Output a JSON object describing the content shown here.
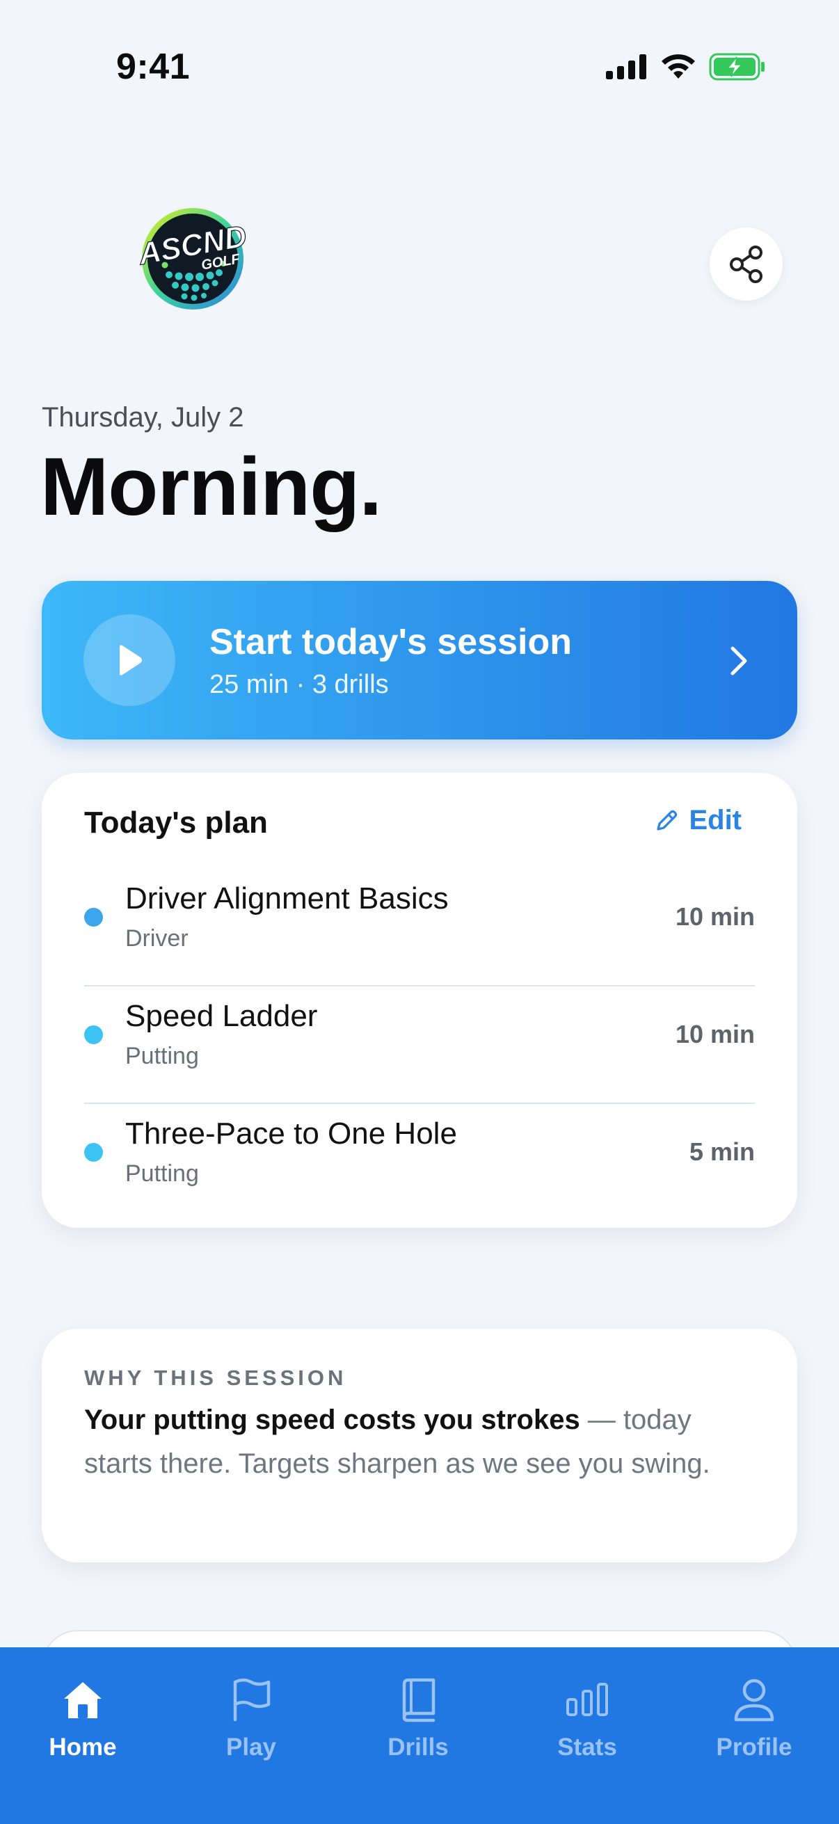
{
  "status_bar": {
    "time": "9:41"
  },
  "header": {
    "logo_text_main": "ASCND",
    "logo_text_sub": "GOLF",
    "date": "Thursday, July 2",
    "greeting": "Morning."
  },
  "session_cta": {
    "title": "Start today's session",
    "subtitle": "25 min · 3 drills"
  },
  "plan": {
    "title": "Today's plan",
    "edit_label": "Edit",
    "drills": [
      {
        "name": "Driver Alignment Basics",
        "category": "Driver",
        "duration": "10 min"
      },
      {
        "name": "Speed Ladder",
        "category": "Putting",
        "duration": "10 min"
      },
      {
        "name": "Three-Pace to One Hole",
        "category": "Putting",
        "duration": "5 min"
      }
    ]
  },
  "why": {
    "label": "WHY THIS SESSION",
    "text_bold": "Your putting speed costs you strokes",
    "text_rest": " — today starts there. Targets sharpen as we see you swing."
  },
  "tabs": [
    {
      "label": "Home",
      "icon": "home-icon",
      "active": true
    },
    {
      "label": "Play",
      "icon": "flag-icon",
      "active": false
    },
    {
      "label": "Drills",
      "icon": "book-icon",
      "active": false
    },
    {
      "label": "Stats",
      "icon": "bar-chart-icon",
      "active": false
    },
    {
      "label": "Profile",
      "icon": "person-icon",
      "active": false
    }
  ],
  "colors": {
    "accent": "#2178e2",
    "cta_gradient_start": "#3db8f8",
    "edit": "#2a84e6",
    "battery": "#34c759"
  }
}
